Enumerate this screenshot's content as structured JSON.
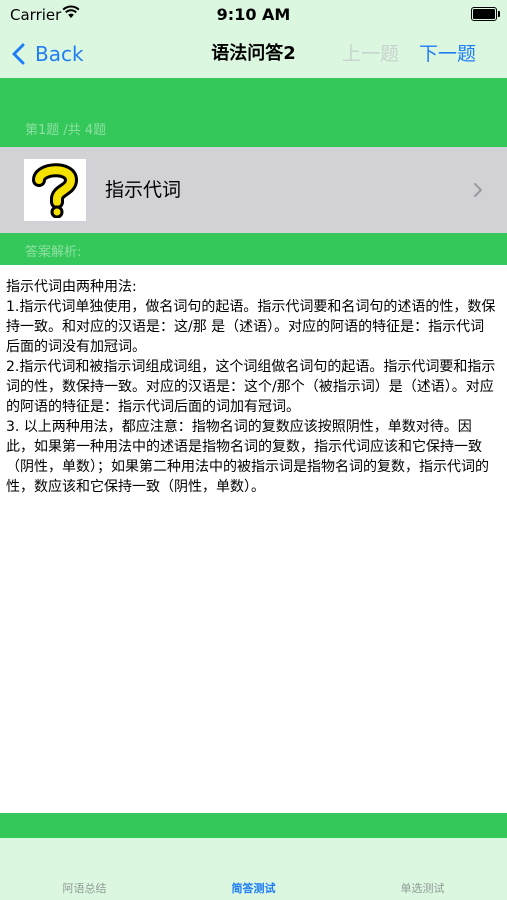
{
  "status_bar": {
    "carrier": "Carrier",
    "time": "9:10 AM"
  },
  "nav": {
    "back_label": "Back",
    "title": "语法问答2",
    "prev_label": "上一题",
    "next_label": "下一题"
  },
  "question": {
    "counter": "第1题 /共 4题",
    "title": "指示代词",
    "thumbnail_icon": "question-mark-icon"
  },
  "answer": {
    "header": "答案解析:",
    "text": "指示代词由两种用法:\n1.指示代词单独使用，做名词句的起语。指示代词要和名词句的述语的性，数保持一致。和对应的汉语是：这/那 是（述语）。对应的阿语的特征是：指示代词后面的词没有加冠词。\n2.指示代词和被指示词组成词组，这个词组做名词句的起语。指示代词要和指示词的性，数保持一致。对应的汉语是：这个/那个（被指示词）是（述语）。对应的阿语的特征是：指示代词后面的词加有冠词。\n3. 以上两种用法，都应注意：指物名词的复数应该按照阴性，单数对待。因此，如果第一种用法中的述语是指物名词的复数，指示代词应该和它保持一致（阴性，单数）；如果第二种用法中的被指示词是指物名词的复数，指示代词的性，数应该和它保持一致（阴性，单数）。"
  },
  "tabs": [
    {
      "label": "阿语总结"
    },
    {
      "label": "简答测试"
    },
    {
      "label": "单选测试"
    }
  ],
  "colors": {
    "accent": "#1f7ef5",
    "green": "#34c759",
    "bar_bg": "#dcf7e0",
    "row_bg": "#d1d1d6"
  }
}
